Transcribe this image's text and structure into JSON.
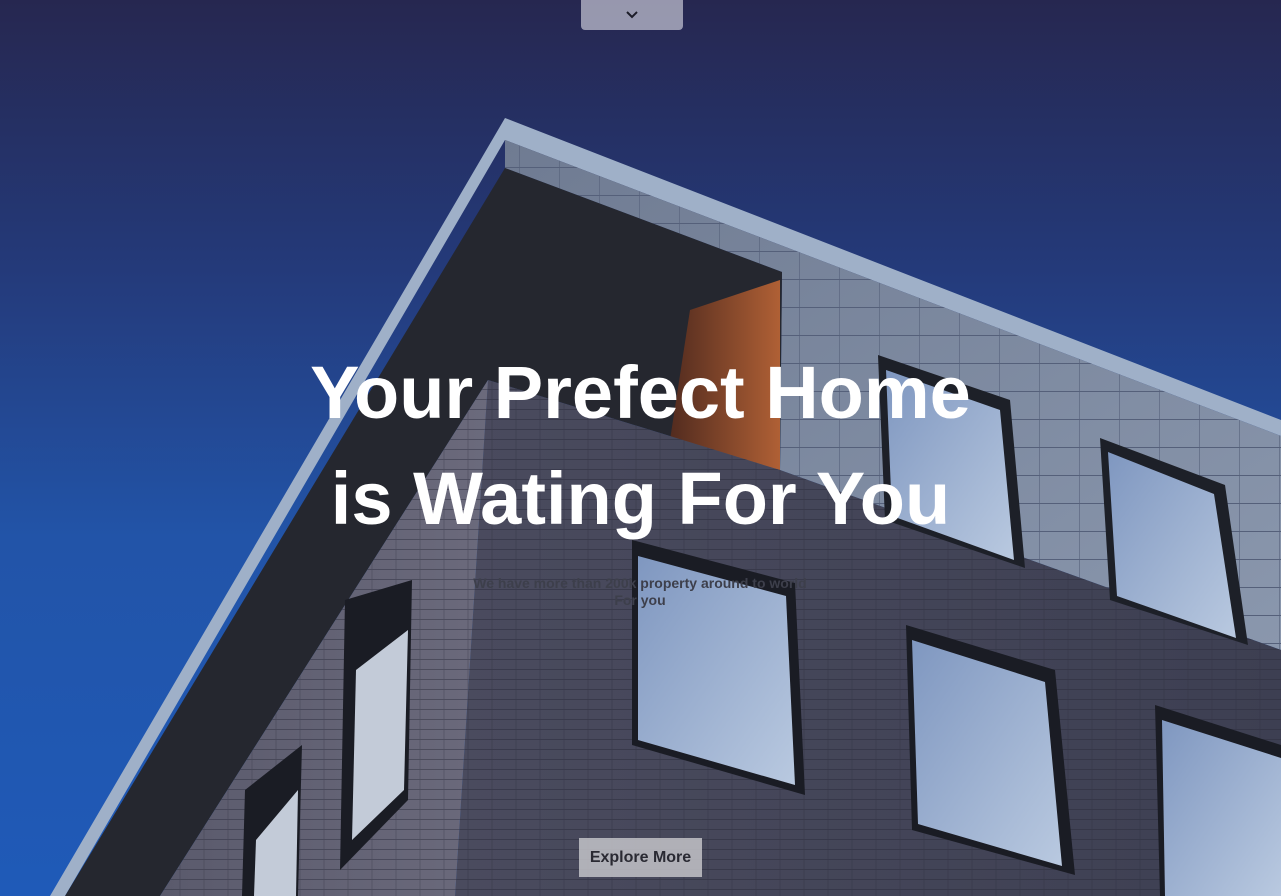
{
  "hero": {
    "headline_line1": "Your Prefect Home",
    "headline_line2": "is Wating For You",
    "subtext": "We have more than 200k property around to world For you",
    "cta_label": "Explore More"
  },
  "nav": {
    "toggle_icon": "chevron-down-icon"
  },
  "colors": {
    "sky_top": "#262750",
    "sky_bottom": "#1f5ab8",
    "headline": "#ffffff",
    "button_bg": "#c3c3c8"
  }
}
